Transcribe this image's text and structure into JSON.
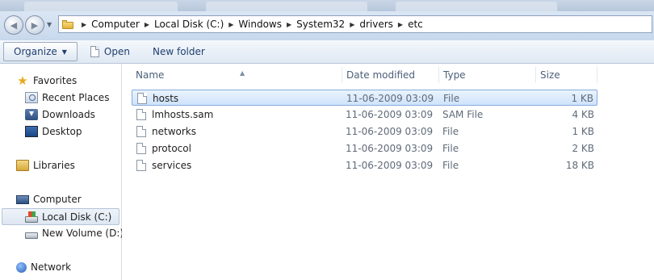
{
  "address_bar": {
    "breadcrumbs": [
      "Computer",
      "Local Disk (C:)",
      "Windows",
      "System32",
      "drivers",
      "etc"
    ]
  },
  "toolbar": {
    "organize_label": "Organize",
    "open_label": "Open",
    "new_folder_label": "New folder"
  },
  "navigation": {
    "favorites": {
      "label": "Favorites",
      "items": [
        "Recent Places",
        "Downloads",
        "Desktop"
      ]
    },
    "libraries": {
      "label": "Libraries"
    },
    "computer": {
      "label": "Computer",
      "items": [
        "Local Disk (C:)",
        "New Volume (D:)"
      ],
      "selected": "Local Disk (C:)"
    },
    "network": {
      "label": "Network"
    }
  },
  "file_list": {
    "columns": [
      "Name",
      "Date modified",
      "Type",
      "Size"
    ],
    "rows": [
      {
        "name": "hosts",
        "date": "11-06-2009 03:09",
        "type": "File",
        "size": "1 KB",
        "selected": true
      },
      {
        "name": "lmhosts.sam",
        "date": "11-06-2009 03:09",
        "type": "SAM File",
        "size": "4 KB"
      },
      {
        "name": "networks",
        "date": "11-06-2009 03:09",
        "type": "File",
        "size": "1 KB"
      },
      {
        "name": "protocol",
        "date": "11-06-2009 03:09",
        "type": "File",
        "size": "2 KB"
      },
      {
        "name": "services",
        "date": "11-06-2009 03:09",
        "type": "File",
        "size": "18 KB"
      }
    ]
  },
  "colors": {
    "selection_fill": "#cfe3fb",
    "selection_border": "#84acdd",
    "header_text": "#4c607a",
    "command_text": "#1e3f6f"
  }
}
